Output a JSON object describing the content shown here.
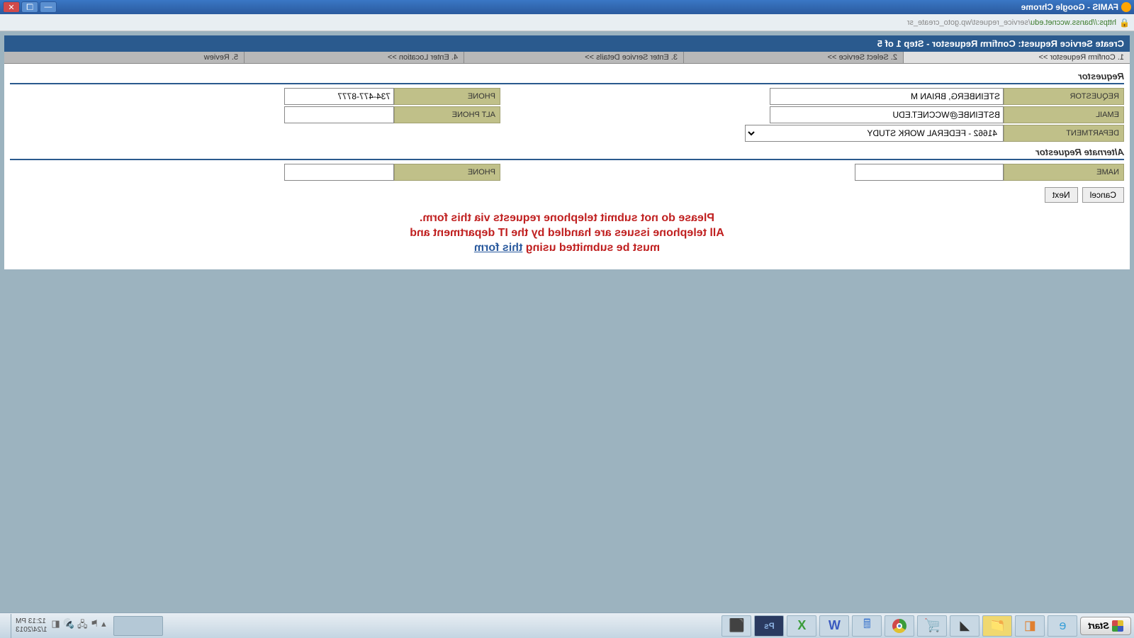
{
  "window": {
    "title": "FAMIS - Google Chrome"
  },
  "url": {
    "scheme": "https",
    "host": "://banss.wccnet.edu",
    "path": "/service_request/wp.goto_create_sr"
  },
  "header": {
    "title": "Create Service Request: Confirm Requestor - Step 1 of 5"
  },
  "steps": [
    {
      "label": "1. Confirm Requestor >>"
    },
    {
      "label": "2. Select Service >>"
    },
    {
      "label": "3. Enter Service Details >>"
    },
    {
      "label": "4. Enter Location >>"
    },
    {
      "label": "5. Review"
    }
  ],
  "sections": {
    "requestor_title": "Requestor",
    "alternate_title": "Alternate Requestor"
  },
  "labels": {
    "requestor": "REQUESTOR",
    "phone": "PHONE",
    "email": "EMAIL",
    "alt_phone": "ALT PHONE",
    "department": "DEPARTMENT",
    "name": "NAME"
  },
  "values": {
    "requestor": "STEINBERG, BRIAN M",
    "phone": "734-477-8777",
    "email": "BSTEINBE@WCCNET.EDU",
    "alt_phone": "",
    "department": "41662 - FEDERAL WORK STUDY",
    "alt_name": "",
    "alt_phone2": ""
  },
  "buttons": {
    "cancel": "Cancel",
    "next": "Next"
  },
  "notice": {
    "line1": "Please do not submit telephone requests via this form.",
    "line2": "All telephone issues are handled by the IT department and",
    "line3a": "must be submitted using ",
    "line3b": "this form"
  },
  "taskbar": {
    "start": "Start",
    "time": "12:13 PM",
    "date": "1/24/2013"
  }
}
